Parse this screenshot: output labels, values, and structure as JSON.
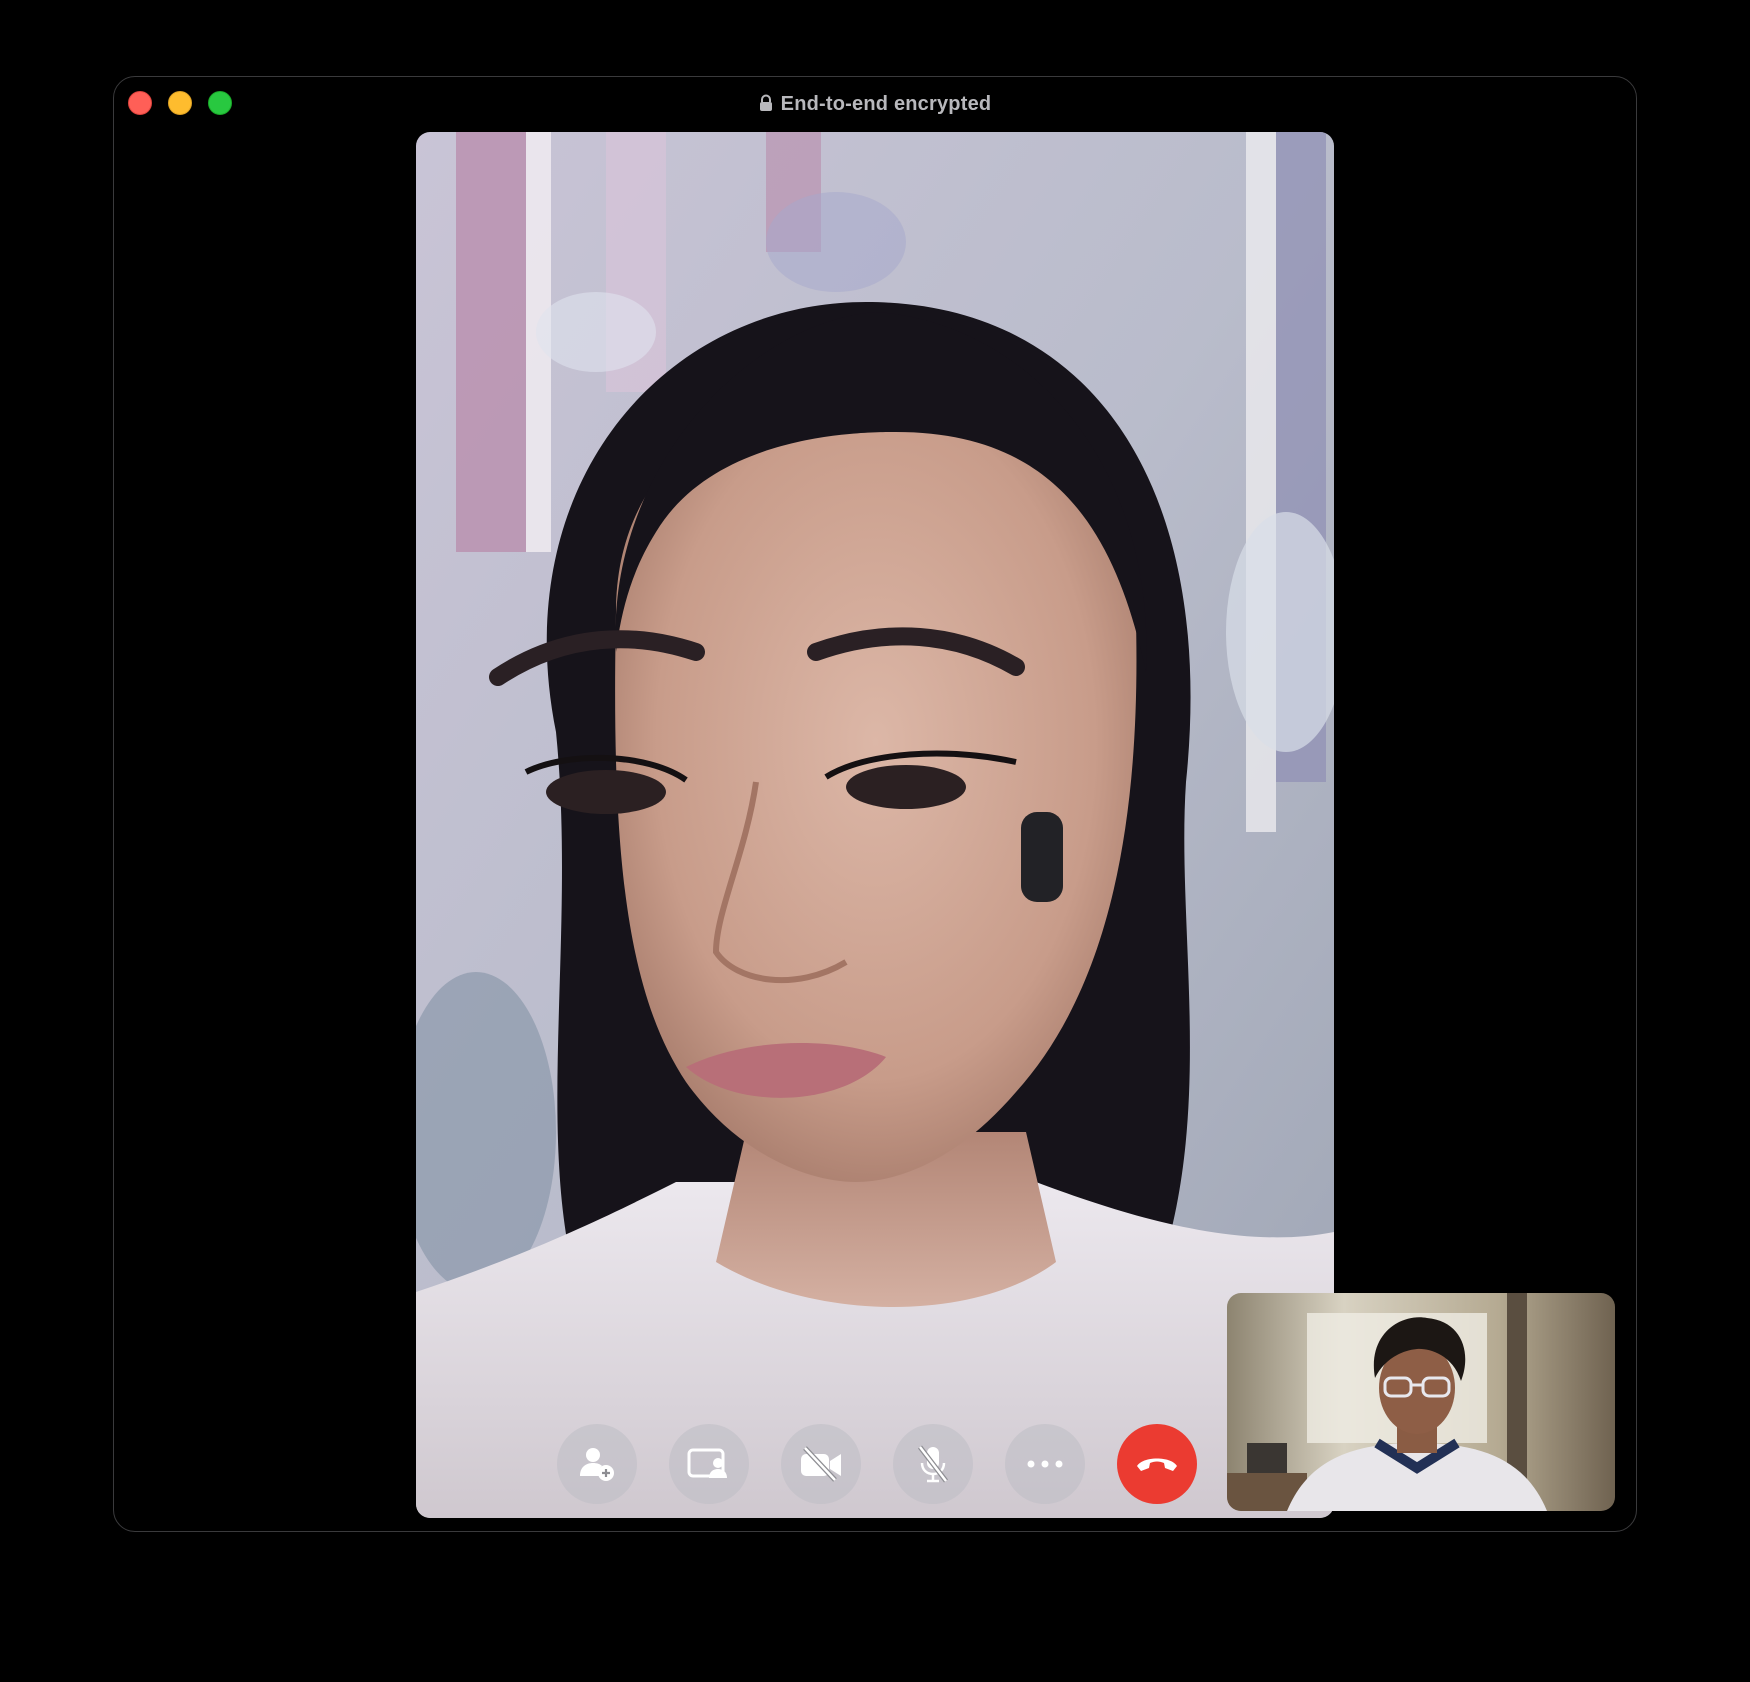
{
  "window": {
    "title": "End-to-end encrypted",
    "traffic_lights": [
      "close",
      "minimize",
      "zoom"
    ]
  },
  "remote_video": {
    "description_icon": "remote-participant-video"
  },
  "self_view": {
    "description_icon": "self-camera-preview"
  },
  "controls": [
    {
      "name": "add-people",
      "icon": "person-plus-icon"
    },
    {
      "name": "share-screen",
      "icon": "screen-share-icon"
    },
    {
      "name": "camera-off",
      "icon": "video-slash-icon"
    },
    {
      "name": "mute",
      "icon": "mic-slash-icon"
    },
    {
      "name": "more",
      "icon": "ellipsis-icon"
    },
    {
      "name": "end-call",
      "icon": "phone-down-icon"
    }
  ],
  "colors": {
    "end_call": "#eb3b31",
    "close": "#ff5f57",
    "minimize": "#febc2e",
    "zoom": "#28c840",
    "title_text": "#b8b8bc"
  }
}
